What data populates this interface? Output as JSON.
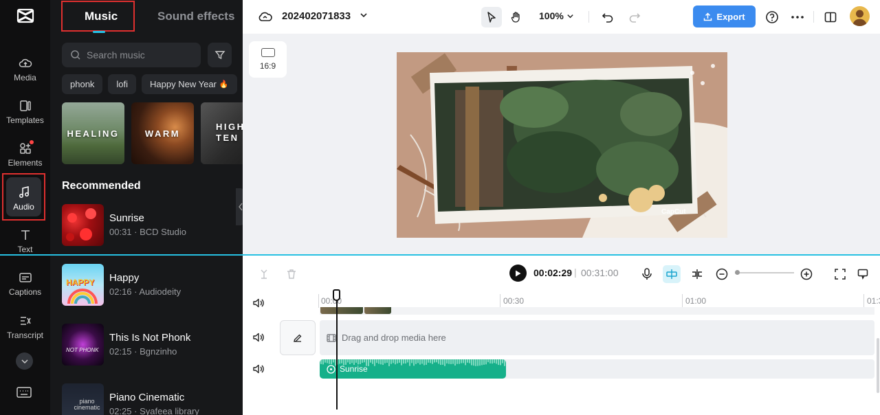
{
  "rail": {
    "items": [
      {
        "label": "Media",
        "icon": "media-cloud-icon"
      },
      {
        "label": "Templates",
        "icon": "templates-icon"
      },
      {
        "label": "Elements",
        "icon": "elements-icon"
      },
      {
        "label": "Audio",
        "icon": "music-note-icon"
      },
      {
        "label": "Text",
        "icon": "text-icon"
      },
      {
        "label": "Captions",
        "icon": "captions-icon"
      },
      {
        "label": "Transcript",
        "icon": "transcript-icon"
      }
    ],
    "active": "Audio"
  },
  "panel": {
    "tabs": {
      "music": "Music",
      "sound_effects": "Sound effects"
    },
    "search_placeholder": "Search music",
    "chips": [
      "phonk",
      "lofi",
      "Happy New Year"
    ],
    "genres": [
      "HEALING",
      "WARM",
      "HIGH TEN"
    ],
    "recommended_title": "Recommended",
    "tracks": [
      {
        "name": "Sunrise",
        "meta": "00:31 · BCD Studio"
      },
      {
        "name": "Happy",
        "meta": "02:16 · Audiodeity"
      },
      {
        "name": "This Is Not Phonk",
        "meta": "02:15 · Bgnzinho"
      },
      {
        "name": "Piano Cinematic",
        "meta": "02:25 · Syafeea library"
      }
    ],
    "thumb_text": {
      "happy": "HAPPY",
      "phonk": "NOT PHONK",
      "piano": "piano cinematic"
    }
  },
  "topbar": {
    "project_name": "202402071833",
    "zoom": "100%",
    "export_label": "Export"
  },
  "canvas": {
    "ratio_label": "16:9",
    "watermark": "CapCut"
  },
  "timeline": {
    "current_time": "00:02:29",
    "separator": "|",
    "total_time": "00:31:00",
    "ruler": [
      "00:00",
      "00:30",
      "01:00",
      "01:3"
    ],
    "drop_hint": "Drag and drop media here",
    "audio_clip_name": "Sunrise"
  },
  "colors": {
    "accent": "#3b8bef",
    "highlight_box": "#e0302f",
    "audio_clip": "#16b08a",
    "playline": "#27c0e2"
  }
}
